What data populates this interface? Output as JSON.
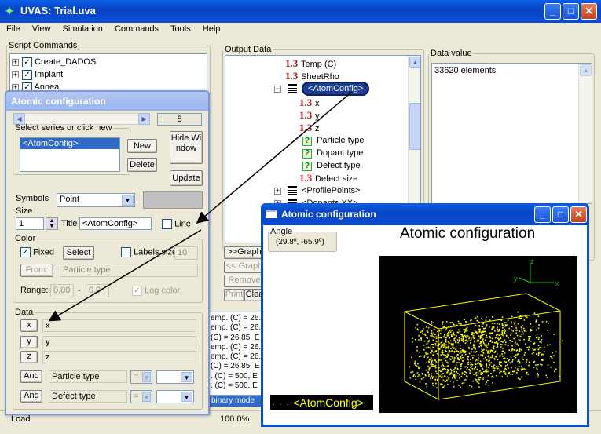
{
  "main": {
    "title": "UVAS: Trial.uva",
    "menu": [
      "File",
      "View",
      "Simulation",
      "Commands",
      "Tools",
      "Help"
    ],
    "script_commands": {
      "label": "Script Commands",
      "items": [
        "Create_DADOS",
        "Implant",
        "Anneal"
      ]
    },
    "output": {
      "label": "Output Data",
      "items": [
        {
          "icon": "1.3",
          "label": "Temp (C)"
        },
        {
          "icon": "1.3",
          "label": "SheetRho"
        },
        {
          "icon": "list",
          "label": "<AtomConfig>"
        },
        {
          "icon": "1.3",
          "label": "x"
        },
        {
          "icon": "1.3",
          "label": "y"
        },
        {
          "icon": "1.3",
          "label": "z"
        },
        {
          "icon": "?",
          "label": "Particle type"
        },
        {
          "icon": "?",
          "label": "Dopant type"
        },
        {
          "icon": "?",
          "label": "Defect type"
        },
        {
          "icon": "1.3",
          "label": "Defect size"
        },
        {
          "icon": "list",
          "label": "<ProfilePoints>"
        },
        {
          "icon": "list",
          "label": "<Dopants XX>"
        }
      ]
    },
    "data_value": {
      "label": "Data value",
      "text": "33620 elements"
    },
    "graph_buttons": {
      "graph_add": ">>Graph",
      "graph_remove": "<< Graph",
      "remove": "Remove",
      "print": "Print",
      "clear": "Clea"
    },
    "log_lines": [
      "emp. (C) = 26.",
      "emp. (C) = 26.",
      "(C) = 26.85, E",
      "emp. (C) = 26.",
      "emp. (C) = 26.",
      "(C) = 26.85, E",
      ". (C) = 500, E",
      ". (C) = 500, E"
    ],
    "log_mode": "binary mode",
    "status": {
      "left": "Load",
      "zoom": "100.0%"
    }
  },
  "atomic_dialog": {
    "title": "Atomic configuration",
    "counter": "8",
    "series_label": "Select series or click new",
    "series": [
      "<AtomConfig>"
    ],
    "new": "New",
    "delete": "Delete",
    "hide_window": "Hide Window",
    "update": "Update",
    "symbols_label": "Symbols",
    "symbols_value": "Point",
    "size_label": "Size",
    "size_value": "1",
    "title_label": "Title",
    "title_value": "<AtomConfig>",
    "line_label": "Line",
    "color": {
      "label": "Color",
      "fixed": "Fixed",
      "select": "Select",
      "labels_size": "Labels size",
      "labels_size_value": "10",
      "from": "From:",
      "from_value": "Particle type",
      "range_label": "Range:",
      "range_min": "0.00",
      "range_sep": "-",
      "range_max": "0.0",
      "log_color": "Log color"
    },
    "data": {
      "label": "Data",
      "rows": [
        {
          "btn": "x",
          "value": "x"
        },
        {
          "btn": "y",
          "value": "y"
        },
        {
          "btn": "z",
          "value": "z"
        }
      ],
      "and_rows": [
        {
          "btn": "And",
          "value": "Particle type",
          "op": "="
        },
        {
          "btn": "And",
          "value": "Defect type",
          "op": "="
        }
      ]
    }
  },
  "graph_window": {
    "title": "Atomic configuration",
    "angle_label": "Angle",
    "angle_value": "(29.8º, -65.9º)",
    "plot_title": "Atomic configuration",
    "legend": "<AtomConfig>",
    "axis_x": "x",
    "axis_y": "y",
    "axis_z": "z"
  },
  "colors": {
    "xp_blue": "#0a4dd4",
    "selection": "#316ac5",
    "point": "#ffff00",
    "plot_bg": "#000000"
  }
}
